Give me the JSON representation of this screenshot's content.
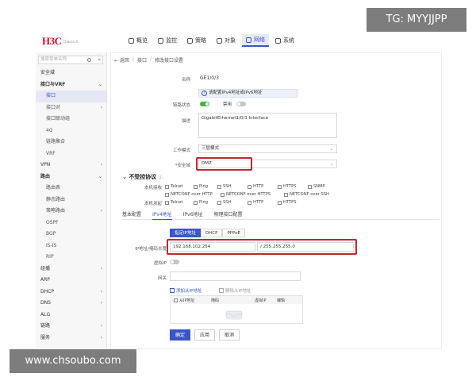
{
  "watermarks": {
    "top": "TG: MYYJJPP",
    "bottom": "www.chsoubo.com"
  },
  "header": {
    "logo_text": "H3C",
    "logo_sub": "Chassis 6",
    "nav": [
      {
        "label": "概览",
        "icon": "overview-icon",
        "active": false
      },
      {
        "label": "监控",
        "icon": "monitor-icon",
        "active": false
      },
      {
        "label": "策略",
        "icon": "policy-icon",
        "active": false
      },
      {
        "label": "对象",
        "icon": "object-icon",
        "active": false
      },
      {
        "label": "网络",
        "icon": "network-icon",
        "active": true
      },
      {
        "label": "系统",
        "icon": "system-icon",
        "active": false
      }
    ]
  },
  "sidebar": {
    "search_placeholder": "搜索菜单名称",
    "items": [
      {
        "label": "安全域",
        "level": 0,
        "chevron": ""
      },
      {
        "label": "接口与VRF",
        "level": 0,
        "chevron": "⌄",
        "bold": true
      },
      {
        "label": "接口",
        "level": 1,
        "chevron": "",
        "active": true
      },
      {
        "label": "接口对",
        "level": 1,
        "chevron": "›"
      },
      {
        "label": "接口联动组",
        "level": 1,
        "chevron": ""
      },
      {
        "label": "4G",
        "level": 1,
        "chevron": ""
      },
      {
        "label": "链路聚合",
        "level": 1,
        "chevron": ""
      },
      {
        "label": "VRF",
        "level": 1,
        "chevron": ""
      },
      {
        "label": "VPN",
        "level": 0,
        "chevron": "›"
      },
      {
        "label": "路由",
        "level": 0,
        "chevron": "⌄",
        "bold": true
      },
      {
        "label": "路由表",
        "level": 1,
        "chevron": ""
      },
      {
        "label": "静态路由",
        "level": 1,
        "chevron": ""
      },
      {
        "label": "策略路由",
        "level": 1,
        "chevron": "›"
      },
      {
        "label": "OSPF",
        "level": 1,
        "chevron": ""
      },
      {
        "label": "BGP",
        "level": 1,
        "chevron": ""
      },
      {
        "label": "IS-IS",
        "level": 1,
        "chevron": ""
      },
      {
        "label": "RIP",
        "level": 1,
        "chevron": ""
      },
      {
        "label": "组播",
        "level": 0,
        "chevron": "›"
      },
      {
        "label": "ARP",
        "level": 0,
        "chevron": ""
      },
      {
        "label": "DHCP",
        "level": 0,
        "chevron": "›"
      },
      {
        "label": "DNS",
        "level": 0,
        "chevron": "›"
      },
      {
        "label": "ALG",
        "level": 0,
        "chevron": ""
      },
      {
        "label": "链路",
        "level": 0,
        "chevron": "›"
      },
      {
        "label": "服务",
        "level": 0,
        "chevron": "›"
      }
    ]
  },
  "breadcrumb": {
    "back": "← 返回",
    "items": [
      "接口",
      "修改接口设置"
    ]
  },
  "form": {
    "name_label": "名称",
    "name_value": "GE1/0/3",
    "tip": "请配置IPv4地址或IPv6地址",
    "link_state_label": "链路状态",
    "toggle_on_text": "开",
    "disable_label": "禁用",
    "desc_label": "描述",
    "desc_value": "GigabitEthernet1/0/3 Interface",
    "work_mode_label": "工作模式",
    "work_mode_value": "三层模式",
    "zone_label": "*安全域",
    "zone_value": "DMZ"
  },
  "protocols": {
    "title": "不受控协议",
    "rows": [
      {
        "label": "本机接收",
        "items": [
          "Telnet",
          "Ping",
          "SSH",
          "HTTP",
          "HTTPS",
          "SNMP"
        ]
      },
      {
        "label": "",
        "items": [
          "NETCONF over HTTP",
          "NETCONF over HTTPS",
          "NETCONF over SSH"
        ]
      },
      {
        "label": "本机发起",
        "items": [
          "Telnet",
          "Ping",
          "SSH",
          "HTTP",
          "HTTPS"
        ]
      }
    ]
  },
  "tabs": [
    "基本配置",
    "IPv4地址",
    "IPv6地址",
    "物理接口配置"
  ],
  "ipv4": {
    "ip_label": "IP地址",
    "modes": [
      "指定IP地址",
      "DHCP",
      "PPPoE"
    ],
    "active_mode": 0,
    "addr_label": "IP地址/掩码长度",
    "ip_value": "192.168.102.254",
    "mask_value": "/ 255.255.255.0",
    "virtual_ip_label": "虚拟IP",
    "gateway_label": "网关",
    "add_secondary": "添加从IP地址",
    "delete_secondary": "删除从IP地址",
    "table_headers": [
      "从IP地址",
      "掩码",
      "虚拟IP",
      "编辑"
    ]
  },
  "actions": {
    "ok": "确定",
    "apply": "应用",
    "cancel": "取消"
  },
  "colors": {
    "accent": "#3b56c7",
    "highlight": "#c2262e",
    "toggle_on": "#43b349",
    "brand": "#c8102e"
  }
}
